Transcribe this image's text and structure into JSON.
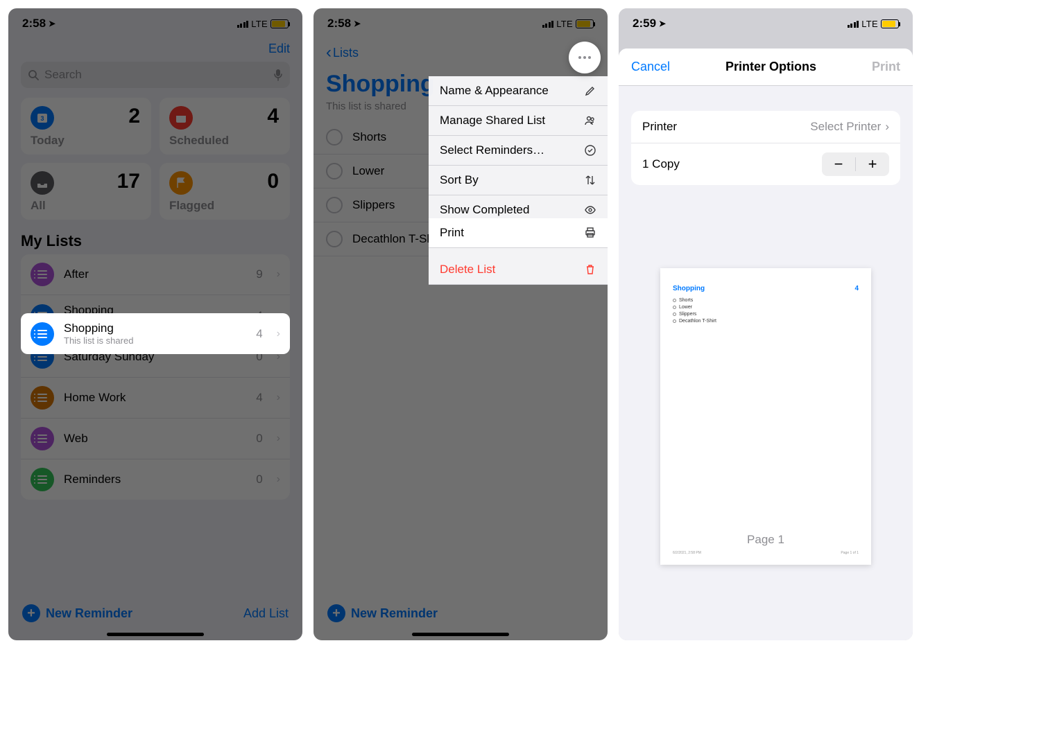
{
  "status": {
    "time_a": "2:58",
    "time_b": "2:59",
    "carrier": "LTE"
  },
  "screen1": {
    "edit": "Edit",
    "search_placeholder": "Search",
    "cards": {
      "today": {
        "label": "Today",
        "count": "2"
      },
      "scheduled": {
        "label": "Scheduled",
        "count": "4"
      },
      "all": {
        "label": "All",
        "count": "17"
      },
      "flagged": {
        "label": "Flagged",
        "count": "0"
      }
    },
    "mylists_header": "My Lists",
    "lists": {
      "after": {
        "title": "After",
        "count": "9",
        "color": "c-purple"
      },
      "shopping": {
        "title": "Shopping",
        "sub": "This list is shared",
        "count": "4",
        "color": "c-blue"
      },
      "satsun": {
        "title": "Saturday Sunday",
        "count": "0",
        "color": "c-blue"
      },
      "homework": {
        "title": "Home Work",
        "count": "4",
        "color": "c-brown"
      },
      "web": {
        "title": "Web",
        "count": "0",
        "color": "c-purple"
      },
      "reminders": {
        "title": "Reminders",
        "count": "0",
        "color": "c-green"
      }
    },
    "new_reminder": "New Reminder",
    "add_list": "Add List"
  },
  "screen2": {
    "back": "Lists",
    "title": "Shopping",
    "subtitle": "This list is shared",
    "items": [
      "Shorts",
      "Lower",
      "Slippers",
      "Decathlon T-Shirt"
    ],
    "menu": {
      "name_appearance": "Name & Appearance",
      "manage_shared": "Manage Shared List",
      "select_reminders": "Select Reminders…",
      "sort_by": "Sort By",
      "show_completed": "Show Completed",
      "print": "Print",
      "delete": "Delete List"
    },
    "new_reminder": "New Reminder"
  },
  "screen3": {
    "cancel": "Cancel",
    "title": "Printer Options",
    "print": "Print",
    "printer_label": "Printer",
    "printer_value": "Select Printer",
    "copies": "1 Copy",
    "preview": {
      "title": "Shopping",
      "count": "4",
      "items": [
        "Shorts",
        "Lower",
        "Slippers",
        "Decathlon T-Shirt"
      ],
      "footer_left": "6/2/2021, 2:58 PM",
      "footer_right": "Page 1 of 1"
    },
    "page_label": "Page 1"
  }
}
